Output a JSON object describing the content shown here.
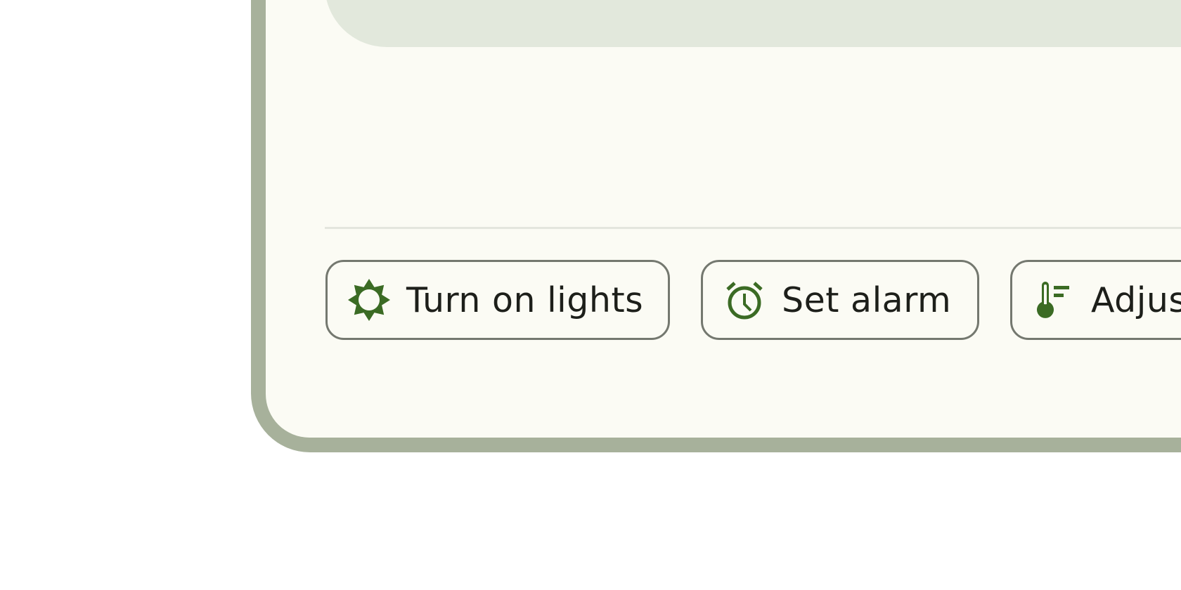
{
  "colors": {
    "frame": "#a7b19b",
    "screen_background": "#fbfbf4",
    "top_panel": "#e2e8dc",
    "chip_border": "#74786f",
    "icon_accent": "#3b6b24",
    "label_text": "#1d1f1a"
  },
  "suggestions": [
    {
      "label": "Turn on lights",
      "icon": "brightness-icon"
    },
    {
      "label": "Set alarm",
      "icon": "alarm-icon"
    },
    {
      "label": "Adjust thermostat",
      "icon": "thermostat-icon"
    }
  ]
}
